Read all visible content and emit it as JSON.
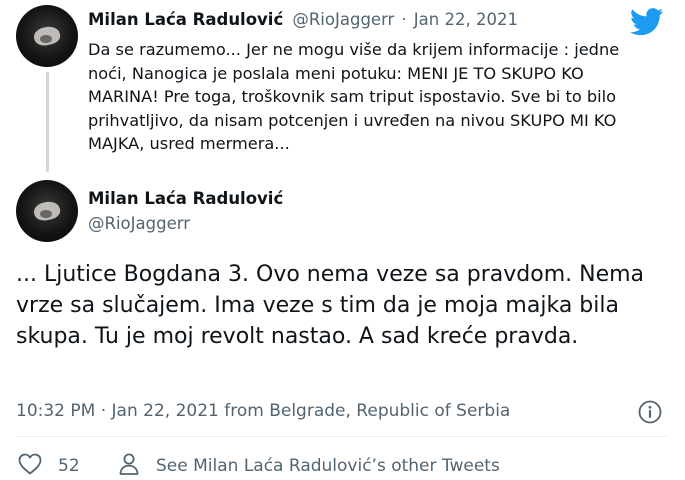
{
  "quoted_tweet": {
    "name": "Milan Laća Radulović",
    "handle": "@RioJaggerr",
    "separator": "·",
    "date": "Jan 22, 2021",
    "text": "Da se razumemo... Jer ne mogu više da krijem informacije : jedne noći, Nanogica je poslala meni potuku: MENI JE TO SKUPO KO MARINA! Pre toga, troškovnik sam triput ispostavio. Sve bi to bilo prihvatljivo, da nisam potcenjen i uvređen na nivou SKUPO MI KO MAJKA, usred mermera..."
  },
  "main_tweet": {
    "name": "Milan Laća Radulović",
    "handle": "@RioJaggerr",
    "text": "... Ljutice Bogdana 3. Ovo nema veze sa pravdom. Nema vrze sa slučajem. Ima veze s tim da je moja majka bila skupa. Tu je moj revolt nastao. A sad kreće pravda.",
    "time": "10:32 PM · Jan 22, 2021 from Belgrade, Republic of Serbia"
  },
  "actions": {
    "like_count": "52",
    "other_tweets": "See Milan Laća Radulović’s other Tweets"
  },
  "icons": {
    "brand": "twitter-bird-icon",
    "info": "info-icon",
    "like": "heart-icon",
    "profile": "person-icon"
  },
  "colors": {
    "brand": "#1d9bf0",
    "text": "#0f1419",
    "secondary": "#536471",
    "divider": "#eff3f4"
  }
}
